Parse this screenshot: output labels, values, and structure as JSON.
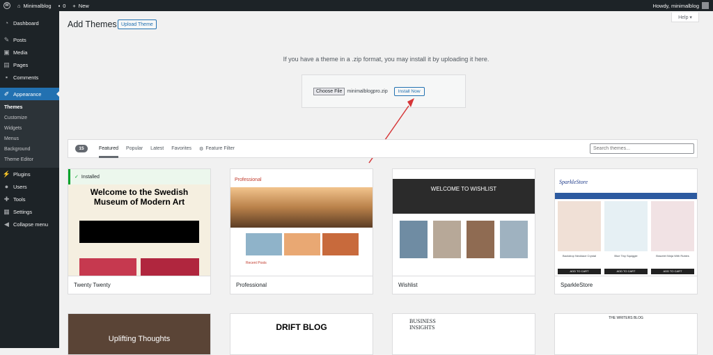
{
  "adminbar": {
    "site": "Minimalblog",
    "comments_count": "0",
    "new": "New",
    "howdy": "Howdy, minimalblog"
  },
  "menu": {
    "items": [
      "Dashboard",
      "Posts",
      "Media",
      "Pages",
      "Comments",
      "Appearance",
      "Plugins",
      "Users",
      "Tools",
      "Settings",
      "Collapse menu"
    ],
    "sub": [
      "Themes",
      "Customize",
      "Widgets",
      "Menus",
      "Background",
      "Theme Editor"
    ]
  },
  "page": {
    "help": "Help ▾",
    "title": "Add Themes",
    "upload_button": "Upload Theme",
    "upload_message": "If you have a theme in a .zip format, you may install it by uploading it here.",
    "choose_file": "Choose File",
    "file_name": "minimalblogpro.zip",
    "install_now": "Install Now"
  },
  "filter": {
    "count": "15",
    "tabs": [
      "Featured",
      "Popular",
      "Latest",
      "Favorites"
    ],
    "feature_filter": "Feature Filter",
    "search_placeholder": "Search themes..."
  },
  "themes": [
    {
      "name": "Twenty Twenty",
      "installed": "Installed",
      "headline": "Welcome to the Swedish Museum of Modern Art"
    },
    {
      "name": "Professional",
      "logo": "Professional",
      "section": "Recent Posts"
    },
    {
      "name": "Wishlist",
      "headline": "WELCOME TO WISHLIST"
    },
    {
      "name": "SparkleStore",
      "logo": "SparkleStore",
      "products": [
        "Backdrop Necklace Crystal",
        "Blue Tiny Squiggle",
        "Bracelet Ninja With Rubies"
      ],
      "add_to_cart": "ADD TO CART"
    }
  ],
  "themes_row2": [
    {
      "headline": "Uplifting Thoughts"
    },
    {
      "headline": "DRIFT BLOG"
    },
    {
      "headline": "BUSINESS INSIGHTS"
    },
    {
      "headline": "THE WRITERS BLOG"
    }
  ],
  "colors": {
    "accent": "#2271b1",
    "sidebar": "#1d2327",
    "arrow": "#d63638"
  }
}
